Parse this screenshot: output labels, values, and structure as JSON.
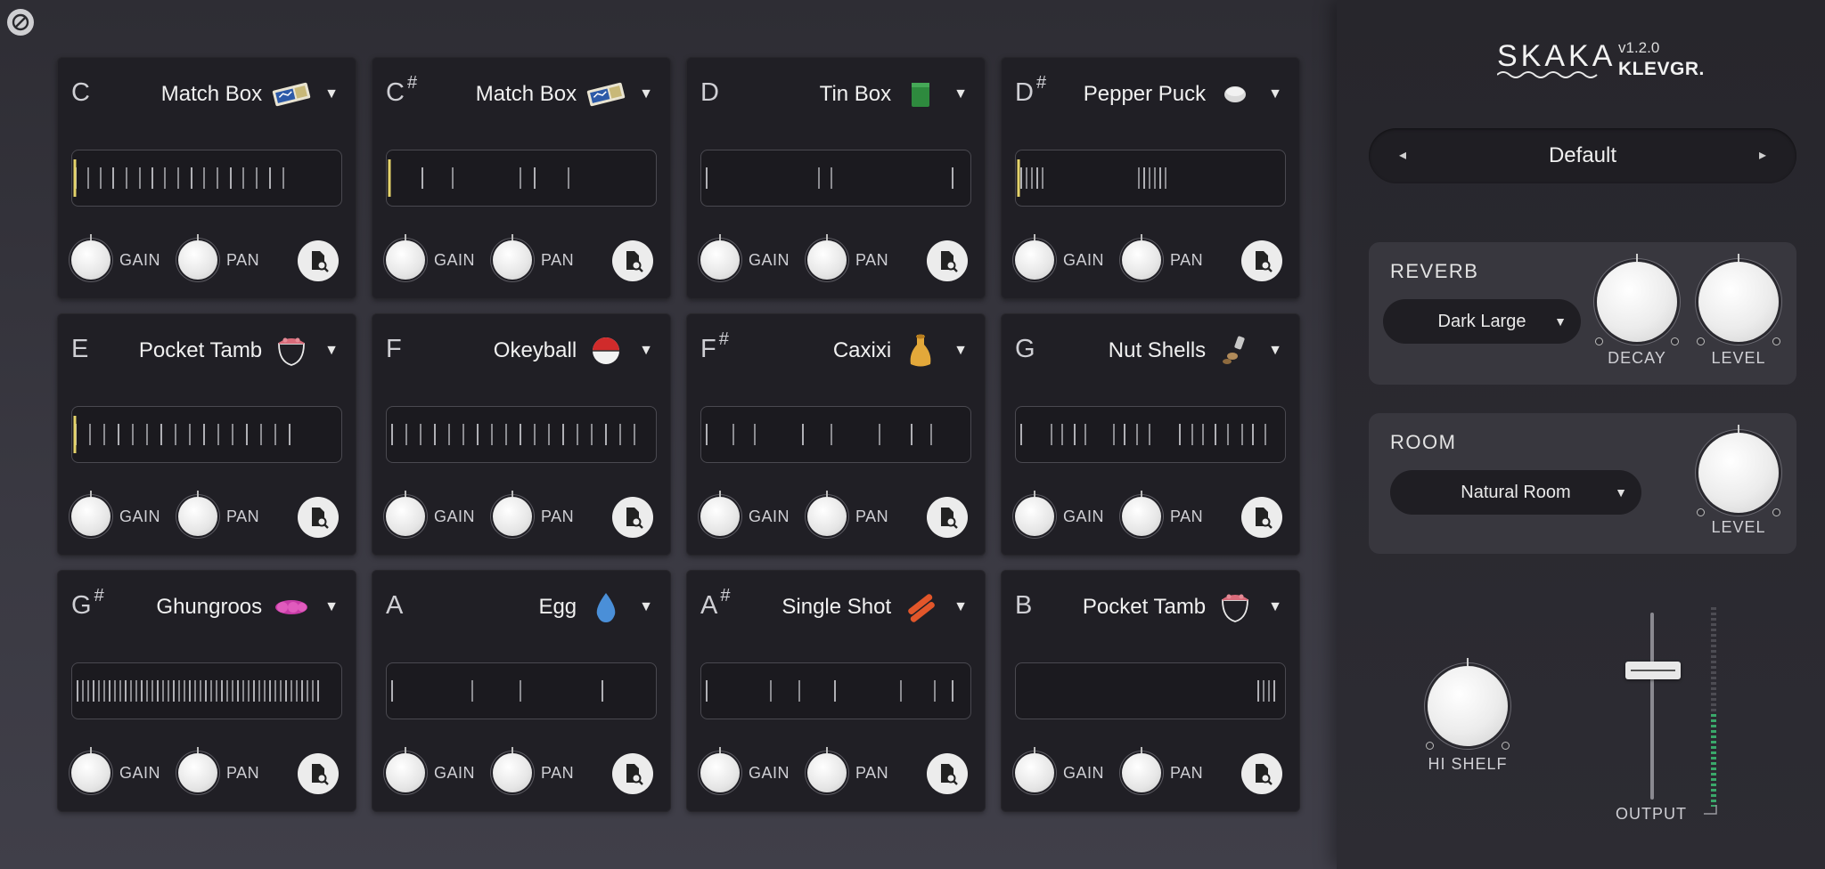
{
  "pads": [
    {
      "note": "C",
      "sharp": "",
      "instrument": "Match Box",
      "icon": "matchbox-icon",
      "gain_label": "GAIN",
      "pan_label": "PAN",
      "hits": [
        4,
        18,
        32,
        46,
        61,
        76,
        90,
        104,
        119,
        134,
        148,
        163,
        178,
        192,
        207,
        222,
        237
      ],
      "playhead": true
    },
    {
      "note": "C",
      "sharp": "#",
      "instrument": "Match Box",
      "icon": "matchbox-icon",
      "gain_label": "GAIN",
      "pan_label": "PAN",
      "hits": [
        40,
        74,
        150,
        166,
        204
      ],
      "playhead": true
    },
    {
      "note": "D",
      "sharp": "",
      "instrument": "Tin Box",
      "icon": "tin-box-icon",
      "gain_label": "GAIN",
      "pan_label": "PAN",
      "hits": [
        6,
        132,
        146,
        282
      ],
      "playhead": false
    },
    {
      "note": "D",
      "sharp": "#",
      "instrument": "Pepper Puck",
      "icon": "pepper-puck-icon",
      "gain_label": "GAIN",
      "pan_label": "PAN",
      "hits": [
        6,
        12,
        18,
        24,
        30,
        138,
        144,
        150,
        156,
        162,
        168
      ],
      "playhead": true
    },
    {
      "note": "E",
      "sharp": "",
      "instrument": "Pocket Tamb",
      "icon": "pocket-tamb-icon",
      "gain_label": "GAIN",
      "pan_label": "PAN",
      "hits": [
        4,
        20,
        36,
        52,
        68,
        84,
        100,
        116,
        132,
        148,
        164,
        180,
        196,
        212,
        228,
        244
      ],
      "playhead": true
    },
    {
      "note": "F",
      "sharp": "",
      "instrument": "Okeyball",
      "icon": "okeyball-icon",
      "gain_label": "GAIN",
      "pan_label": "PAN",
      "hits": [
        6,
        22,
        38,
        54,
        70,
        86,
        102,
        118,
        134,
        150,
        166,
        182,
        198,
        214,
        230,
        246,
        262,
        278
      ],
      "playhead": false
    },
    {
      "note": "F",
      "sharp": "#",
      "instrument": "Caxixi",
      "icon": "caxixi-icon",
      "gain_label": "GAIN",
      "pan_label": "PAN",
      "hits": [
        6,
        36,
        60,
        114,
        146,
        200,
        236,
        258
      ],
      "playhead": false
    },
    {
      "note": "G",
      "sharp": "",
      "instrument": "Nut Shells",
      "icon": "nut-shells-icon",
      "gain_label": "GAIN",
      "pan_label": "PAN",
      "hits": [
        6,
        40,
        52,
        66,
        78,
        110,
        122,
        136,
        150,
        184,
        198,
        210,
        224,
        238,
        254,
        266,
        280
      ],
      "playhead": false
    },
    {
      "note": "G",
      "sharp": "#",
      "instrument": "Ghungroos",
      "icon": "ghungroos-icon",
      "gain_label": "GAIN",
      "pan_label": "PAN",
      "hits": [
        6,
        12,
        18,
        24,
        30,
        36,
        42,
        48,
        54,
        60,
        66,
        72,
        78,
        84,
        90,
        96,
        102,
        108,
        114,
        120,
        126,
        132,
        138,
        144,
        150,
        156,
        162,
        168,
        174,
        180,
        186,
        192,
        198,
        204,
        210,
        216,
        222,
        228,
        234,
        240,
        246,
        252,
        258,
        264,
        270,
        276
      ],
      "playhead": false
    },
    {
      "note": "A",
      "sharp": "",
      "instrument": "Egg",
      "icon": "egg-icon",
      "gain_label": "GAIN",
      "pan_label": "PAN",
      "hits": [
        6,
        96,
        150,
        242
      ],
      "playhead": false
    },
    {
      "note": "A",
      "sharp": "#",
      "instrument": "Single Shot",
      "icon": "single-shot-icon",
      "gain_label": "GAIN",
      "pan_label": "PAN",
      "hits": [
        6,
        78,
        110,
        150,
        224,
        262,
        282
      ],
      "playhead": false
    },
    {
      "note": "B",
      "sharp": "",
      "instrument": "Pocket Tamb",
      "icon": "pocket-tamb-icon",
      "gain_label": "GAIN",
      "pan_label": "PAN",
      "hits": [
        272,
        278,
        284,
        290
      ],
      "playhead": false
    }
  ],
  "header": {
    "product": "SKAKA",
    "version": "v1.2.0",
    "brand": "KLEVGR."
  },
  "preset": {
    "name": "Default",
    "prev": "◂",
    "next": "▸"
  },
  "reverb": {
    "title": "REVERB",
    "type": "Dark Large",
    "decay_label": "DECAY",
    "level_label": "LEVEL"
  },
  "room": {
    "title": "ROOM",
    "type": "Natural Room",
    "level_label": "LEVEL"
  },
  "output": {
    "hishelf_label": "HI SHELF",
    "output_label": "OUTPUT",
    "fader_level": 0.69
  },
  "colors": {
    "accent_playhead": "#e4d36a",
    "meter_green": "#3aa86a"
  }
}
